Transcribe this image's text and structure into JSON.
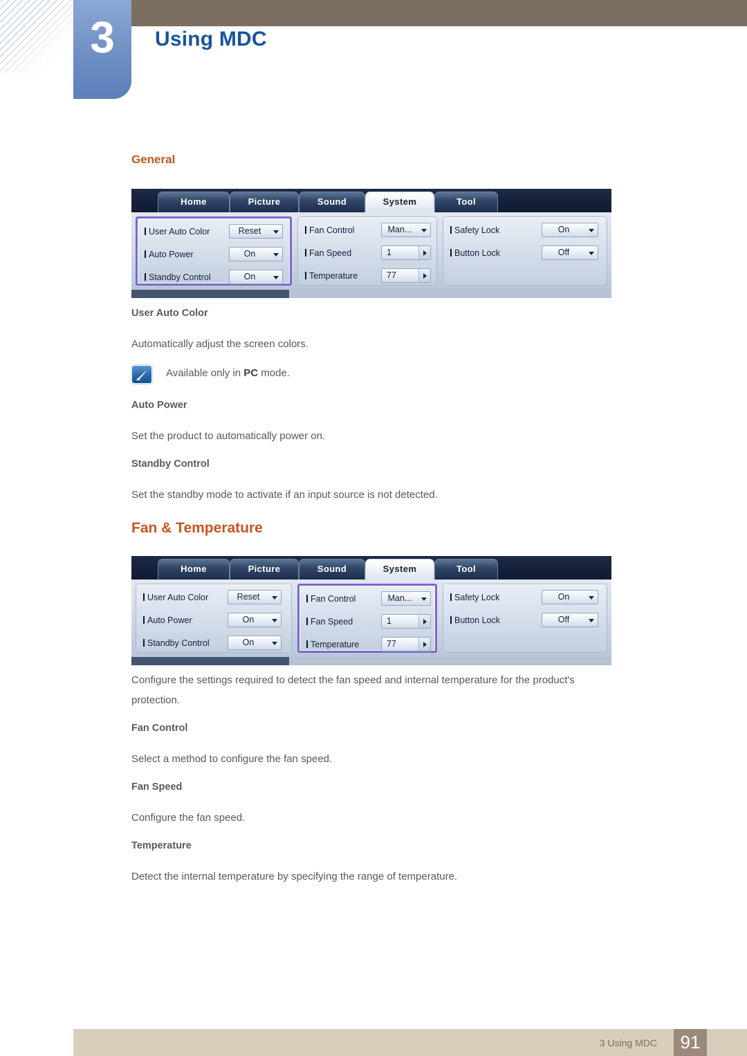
{
  "header": {
    "chapter_number": "3",
    "chapter_title": "Using MDC"
  },
  "sections": {
    "general_heading": "General",
    "fan_temp_heading": "Fan & Temperature"
  },
  "general_body": {
    "user_auto_color_title": "User Auto Color",
    "user_auto_color_text": "Automatically adjust the screen colors.",
    "note_prefix": "Available only in ",
    "note_bold": "PC",
    "note_suffix": " mode.",
    "auto_power_title": "Auto Power",
    "auto_power_text": "Set the product to automatically power on.",
    "standby_control_title": "Standby Control",
    "standby_control_text": "Set the standby mode to activate if an input source is not detected."
  },
  "fan_temp_body": {
    "intro_line1": "Configure the settings required to detect the fan speed and internal temperature for the product's",
    "intro_line2": "protection.",
    "fan_control_title": "Fan Control",
    "fan_control_text": "Select a method to configure the fan speed.",
    "fan_speed_title": "Fan Speed",
    "fan_speed_text": "Configure the fan speed.",
    "temperature_title": "Temperature",
    "temperature_text": "Detect the internal temperature by specifying the range of temperature."
  },
  "mdc": {
    "tabs": [
      {
        "label": "Home",
        "active": false
      },
      {
        "label": "Picture",
        "active": false
      },
      {
        "label": "Sound",
        "active": false
      },
      {
        "label": "System",
        "active": true
      },
      {
        "label": "Tool",
        "active": false
      }
    ],
    "group_general": [
      {
        "label": "User Auto Color",
        "value": "Reset",
        "kind": "dropdown"
      },
      {
        "label": "Auto Power",
        "value": "On",
        "kind": "dropdown"
      },
      {
        "label": "Standby Control",
        "value": "On",
        "kind": "dropdown"
      }
    ],
    "group_fan": [
      {
        "label": "Fan Control",
        "value": "Man...",
        "kind": "dropdown"
      },
      {
        "label": "Fan Speed",
        "value": "1",
        "kind": "spinner"
      },
      {
        "label": "Temperature",
        "value": "77",
        "kind": "spinner"
      }
    ],
    "group_lock": [
      {
        "label": "Safety Lock",
        "value": "On",
        "kind": "dropdown"
      },
      {
        "label": "Button Lock",
        "value": "Off",
        "kind": "dropdown"
      }
    ],
    "highlight_general": "group_general",
    "highlight_fan": "group_fan"
  },
  "footer": {
    "label": "3 Using MDC",
    "page_number": "91"
  },
  "colors": {
    "accent_orange": "#c4561f",
    "chapter_blue": "#19549b",
    "brown_bar": "#7c6e60",
    "footer_bar": "#d9cdbc",
    "footer_page_box": "#9b8a7c",
    "highlight_purple": "#7b68cf"
  }
}
